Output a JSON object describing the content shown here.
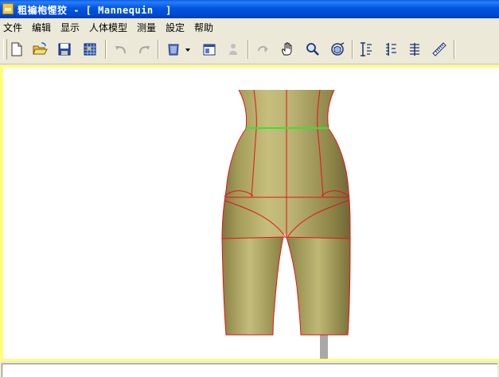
{
  "window": {
    "title": "粗褊枹惺狡 - [ Mannequin  ]"
  },
  "menu": [
    "文件",
    "编辑",
    "显示",
    "人体模型",
    "测量",
    "設定",
    "帮助"
  ],
  "toolbar": {
    "buttons": [
      {
        "name": "new-file-button",
        "icon": "new-file-icon",
        "enabled": true
      },
      {
        "name": "open-file-button",
        "icon": "open-folder-icon",
        "enabled": true
      },
      {
        "name": "save-button",
        "icon": "floppy-disk-icon",
        "enabled": true
      },
      {
        "name": "print-button",
        "icon": "grid-icon",
        "enabled": true
      },
      {
        "name": "undo-button",
        "icon": "undo-icon",
        "enabled": false
      },
      {
        "name": "redo-button",
        "icon": "redo-icon",
        "enabled": false
      },
      {
        "name": "mannequin-view-button",
        "icon": "mannequin-icon",
        "enabled": true
      },
      {
        "name": "window-view-button",
        "icon": "window-icon",
        "enabled": true
      },
      {
        "name": "figure-button",
        "icon": "figure-icon",
        "enabled": false
      },
      {
        "name": "rotate-button",
        "icon": "rotate-icon",
        "enabled": false
      },
      {
        "name": "pan-button",
        "icon": "hand-icon",
        "enabled": true
      },
      {
        "name": "zoom-button",
        "icon": "magnifier-icon",
        "enabled": true
      },
      {
        "name": "zoom-fit-button",
        "icon": "cube-icon",
        "enabled": true
      },
      {
        "name": "measure-height-button",
        "icon": "height-measure-icon",
        "enabled": true
      },
      {
        "name": "measure-levels-button",
        "icon": "levels-measure-icon",
        "enabled": true
      },
      {
        "name": "measure-girth-button",
        "icon": "girth-measure-icon",
        "enabled": true
      },
      {
        "name": "ruler-button",
        "icon": "ruler-icon",
        "enabled": true
      }
    ]
  },
  "colors": {
    "body": "#b8b06a",
    "seam": "#e8101a",
    "waistline": "#2ee82e",
    "stand": "#a8a8a8",
    "viewportBorder": "#ffff7a"
  },
  "status": {
    "text": ""
  }
}
